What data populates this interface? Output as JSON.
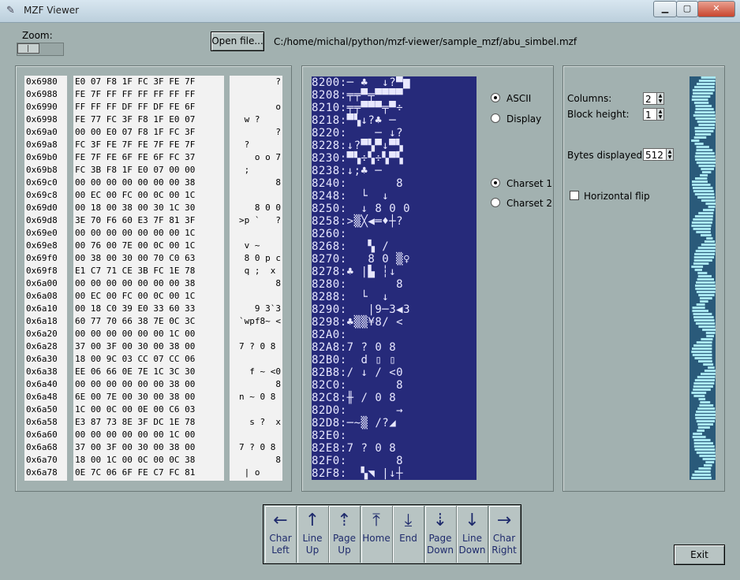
{
  "window": {
    "title": "MZF Viewer",
    "minimize": "▁",
    "maximize": "▢",
    "close": "✕"
  },
  "zoom": {
    "label": "Zoom:"
  },
  "toolbar": {
    "open_label": "Open file...",
    "path": "C:/home/michal/python/mzf-viewer/sample_mzf/abu_simbel.mzf"
  },
  "hex": {
    "addresses": [
      "0x6980",
      "0x6988",
      "0x6990",
      "0x6998",
      "0x69a0",
      "0x69a8",
      "0x69b0",
      "0x69b8",
      "0x69c0",
      "0x69c8",
      "0x69d0",
      "0x69d8",
      "0x69e0",
      "0x69e8",
      "0x69f0",
      "0x69f8",
      "0x6a00",
      "0x6a08",
      "0x6a10",
      "0x6a18",
      "0x6a20",
      "0x6a28",
      "0x6a30",
      "0x6a38",
      "0x6a40",
      "0x6a48",
      "0x6a50",
      "0x6a58",
      "0x6a60",
      "0x6a68",
      "0x6a70",
      "0x6a78"
    ],
    "bytes": [
      "E0 07 F8 1F FC 3F FE 7F",
      "FE 7F FF FF FF FF FF FF",
      "FF FF FF DF FF DF FE 6F",
      "FE 77 FC 3F F8 1F E0 07",
      "00 00 E0 07 F8 1F FC 3F",
      "FC 3F FE 7F FE 7F FE 7F",
      "FE 7F FE 6F FE 6F FC 37",
      "FC 3B F8 1F E0 07 00 00",
      "00 00 00 00 00 00 00 38",
      "00 EC 00 FC 00 0C 00 1C",
      "00 18 00 38 00 30 1C 30",
      "3E 70 F6 60 E3 7F 81 3F",
      "00 00 00 00 00 00 00 1C",
      "00 76 00 7E 00 0C 00 1C",
      "00 38 00 30 00 70 C0 63",
      "E1 C7 71 CE 3B FC 1E 78",
      "00 00 00 00 00 00 00 38",
      "00 EC 00 FC 00 0C 00 1C",
      "00 18 C0 39 E0 33 60 33",
      "60 77 70 66 38 7E 0C 3C",
      "00 00 00 00 00 00 1C 00",
      "37 00 3F 00 30 00 38 00",
      "18 00 9C 03 CC 07 CC 06",
      "EE 06 66 0E 7E 1C 3C 30",
      "00 00 00 00 00 00 38 00",
      "6E 00 7E 00 30 00 38 00",
      "1C 00 0C 00 0E 00 C6 03",
      "E3 87 73 8E 3F DC 1E 78",
      "00 00 00 00 00 00 1C 00",
      "37 00 3F 00 30 00 38 00",
      "18 00 1C 00 0C 00 0C 38",
      "0E 7C 06 6F FE C7 FC 81"
    ],
    "ascii": [
      "       ?",
      "        ",
      "       o",
      " w ?    ",
      "       ?",
      " ?      ",
      "   o o 7",
      " ;      ",
      "       8",
      "        ",
      "   8 0 0",
      ">p `   ?",
      "        ",
      " v ~    ",
      " 8 0 p c",
      " q ;  x ",
      "       8",
      "        ",
      "    9 3`3",
      "`wpf8~ <",
      "        ",
      "7 ? 0 8 ",
      "        ",
      "  f ~ <0",
      "       8",
      "n ~ 0 8 ",
      "        ",
      "  s ?  x",
      "        ",
      "7 ? 0 8 ",
      "       8",
      " | o    "
    ]
  },
  "display": {
    "rows": [
      "8200:─ ♣  ↓?▀▆",
      "8208:╤╤▀╤▀▀▀▀",
      "8210:╤╤▀▀▀╤▀÷",
      "8218:▀▚↓?♣ ─ ",
      "8220:    ─ ↓?",
      "8228:↓?▀▚▀↓▀▚",
      "8230:▀▚÷▚÷▚▀▚",
      "8238:↓;♣ ─   ",
      "8240:       8",
      "8248:  └  ↓  ",
      "8250:  ↓ 8 0 0",
      "8258:>▒╳◀═♦┼?",
      "8260:        ",
      "8268:   ▚ /  ",
      "8270:   8 0 ▒♀",
      "8278:♣ |▙ ┆↓ ",
      "8280:       8",
      "8288:  └  ↓  ",
      "8290:   |9─3◀3",
      "8298:♣▒▒¥8/ <",
      "82A0:        ",
      "82A8:7 ? 0 8 ",
      "82B0:  d ▯ ▯ ",
      "82B8:/ ↓ / <0",
      "82C0:       8",
      "82C8:╫ / 0 8 ",
      "82D0:       →",
      "82D8:─~▒ /?◢ ",
      "82E0:        ",
      "82E8:7 ? 0 8 ",
      "82F0:       8",
      "82F8:  ▚◥ |↓┼"
    ]
  },
  "charset_mode": {
    "ascii": "ASCII",
    "display": "Display",
    "selected": "ascii"
  },
  "charset": {
    "cs1": "Charset 1",
    "cs2": "Charset 2",
    "selected": "cs1"
  },
  "settings": {
    "columns_label": "Columns:",
    "columns_value": "2",
    "block_height_label": "Block height:",
    "block_height_value": "1",
    "bytes_label": "Bytes displayed:",
    "bytes_value": "512",
    "hflip_label": "Horizontal flip",
    "hflip_checked": false
  },
  "nav": [
    {
      "name": "char-left-button",
      "arrow": "←",
      "label": "Char\nLeft"
    },
    {
      "name": "line-up-button",
      "arrow": "↑",
      "label": "Line\nUp"
    },
    {
      "name": "page-up-button",
      "arrow": "⇡",
      "label": "Page\nUp"
    },
    {
      "name": "home-button",
      "arrow": "⤒",
      "label": "Home"
    },
    {
      "name": "end-button",
      "arrow": "⤓",
      "label": "End"
    },
    {
      "name": "page-down-button",
      "arrow": "⇣",
      "label": "Page\nDown"
    },
    {
      "name": "line-down-button",
      "arrow": "↓",
      "label": "Line\nDown"
    },
    {
      "name": "char-right-button",
      "arrow": "→",
      "label": "Char\nRight"
    }
  ],
  "exit_label": "Exit",
  "colors": {
    "screen_bg": "#262a7a",
    "screen_fg": "#e8e8ff",
    "preview_bg": "#2a5a7a",
    "preview_fg": "#a8e6f0"
  }
}
